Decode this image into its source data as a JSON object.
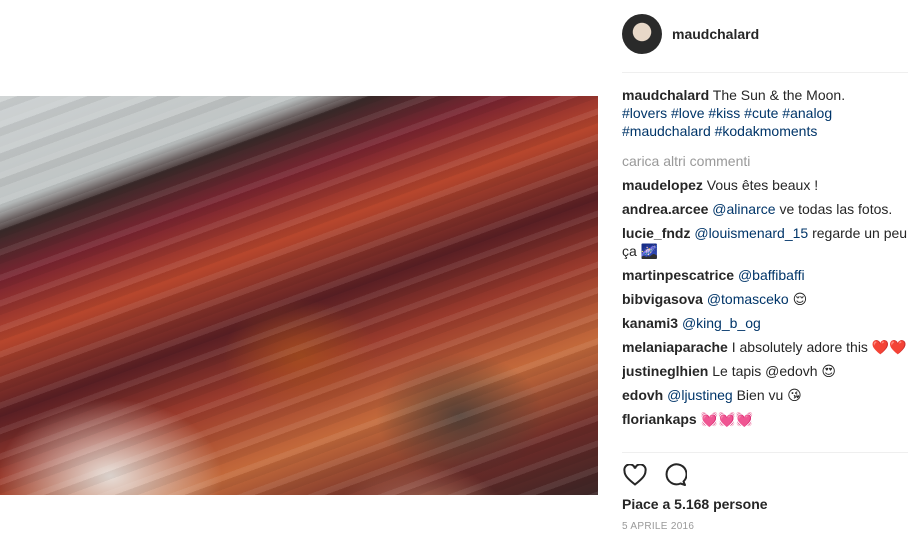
{
  "post": {
    "image_alt": ""
  },
  "header": {
    "username": "maudchalard"
  },
  "caption": {
    "author": "maudchalard",
    "text": "The Sun & the Moon.",
    "hashtags_line1": "#lovers #love #kiss #cute #analog",
    "hashtags_line2": "#maudchalard #kodakmoments"
  },
  "load_more": "carica altri commenti",
  "comments": [
    {
      "user": "maudelopez",
      "text": "Vous êtes beaux !",
      "mention": ""
    },
    {
      "user": "andrea.arcee",
      "mention": "@alinarce",
      "text": "ve todas las fotos."
    },
    {
      "user": "lucie_fndz",
      "mention": "@louismenard_15",
      "text": "regarde un peu ça 🌌"
    },
    {
      "user": "martinpescatrice",
      "mention": "@baffibaffi",
      "text": ""
    },
    {
      "user": "bibvigasova",
      "mention": "@tomasceko",
      "text": "😌"
    },
    {
      "user": "kanami3",
      "mention": "@king_b_og",
      "text": ""
    },
    {
      "user": "melaniaparache",
      "mention": "",
      "text": "I absolutely adore this ❤️❤️"
    },
    {
      "user": "justineglhien",
      "mention": "",
      "text": "Le tapis @edovh 😍"
    },
    {
      "user": "edovh",
      "mention": "@ljustineg",
      "text": "Bien vu 😘"
    },
    {
      "user": "floriankaps",
      "mention": "",
      "text": "💓💓💓"
    }
  ],
  "likes": "Piace a 5.168 persone",
  "date": "5 APRILE 2016",
  "icons": {
    "like": "heart-icon",
    "comment": "comment-icon"
  }
}
